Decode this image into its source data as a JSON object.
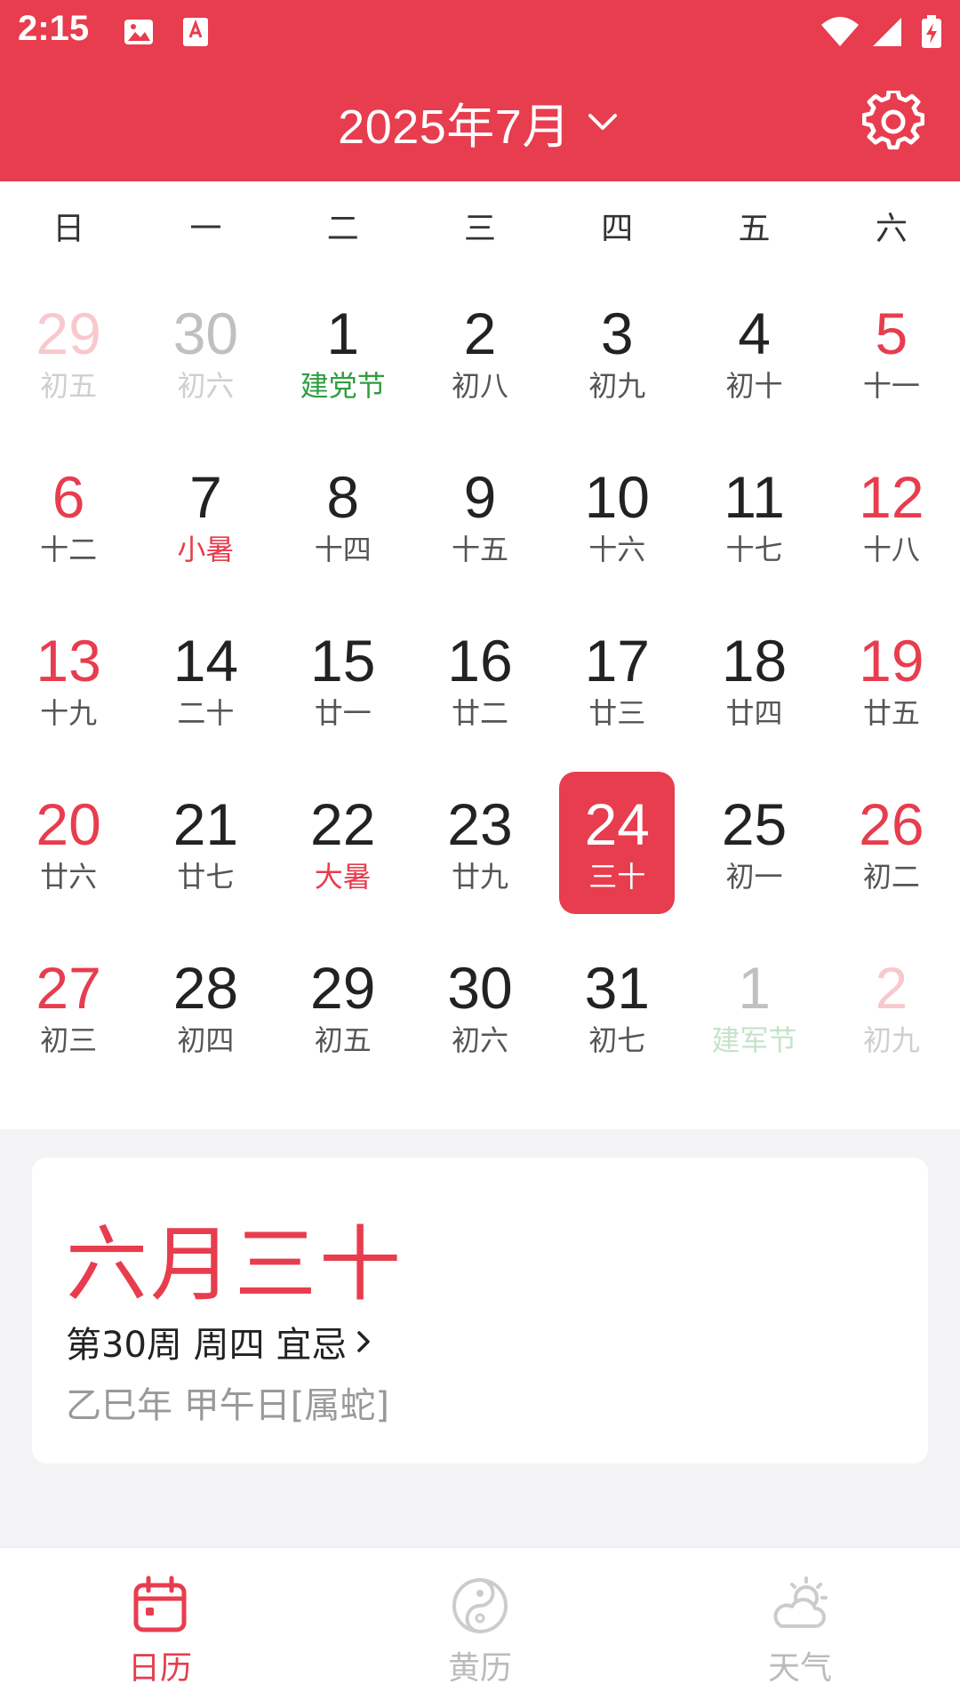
{
  "status": {
    "time": "2:15"
  },
  "header": {
    "title": "2025年7月"
  },
  "weekdays": [
    "日",
    "一",
    "二",
    "三",
    "四",
    "五",
    "六"
  ],
  "days": [
    {
      "num": "29",
      "lunar": "初五",
      "weekend": true,
      "faded": true
    },
    {
      "num": "30",
      "lunar": "初六",
      "faded": true
    },
    {
      "num": "1",
      "lunar": "建党节",
      "lunar_color": "green"
    },
    {
      "num": "2",
      "lunar": "初八"
    },
    {
      "num": "3",
      "lunar": "初九"
    },
    {
      "num": "4",
      "lunar": "初十"
    },
    {
      "num": "5",
      "lunar": "十一",
      "weekend": true
    },
    {
      "num": "6",
      "lunar": "十二",
      "weekend": true
    },
    {
      "num": "7",
      "lunar": "小暑",
      "lunar_color": "red"
    },
    {
      "num": "8",
      "lunar": "十四"
    },
    {
      "num": "9",
      "lunar": "十五"
    },
    {
      "num": "10",
      "lunar": "十六"
    },
    {
      "num": "11",
      "lunar": "十七"
    },
    {
      "num": "12",
      "lunar": "十八",
      "weekend": true
    },
    {
      "num": "13",
      "lunar": "十九",
      "weekend": true
    },
    {
      "num": "14",
      "lunar": "二十"
    },
    {
      "num": "15",
      "lunar": "廿一"
    },
    {
      "num": "16",
      "lunar": "廿二"
    },
    {
      "num": "17",
      "lunar": "廿三"
    },
    {
      "num": "18",
      "lunar": "廿四"
    },
    {
      "num": "19",
      "lunar": "廿五",
      "weekend": true
    },
    {
      "num": "20",
      "lunar": "廿六",
      "weekend": true
    },
    {
      "num": "21",
      "lunar": "廿七"
    },
    {
      "num": "22",
      "lunar": "大暑",
      "lunar_color": "red"
    },
    {
      "num": "23",
      "lunar": "廿九"
    },
    {
      "num": "24",
      "lunar": "三十",
      "selected": true
    },
    {
      "num": "25",
      "lunar": "初一"
    },
    {
      "num": "26",
      "lunar": "初二",
      "weekend": true
    },
    {
      "num": "27",
      "lunar": "初三",
      "weekend": true
    },
    {
      "num": "28",
      "lunar": "初四"
    },
    {
      "num": "29",
      "lunar": "初五"
    },
    {
      "num": "30",
      "lunar": "初六"
    },
    {
      "num": "31",
      "lunar": "初七"
    },
    {
      "num": "1",
      "lunar": "建军节",
      "lunar_color": "green",
      "faded": true
    },
    {
      "num": "2",
      "lunar": "初九",
      "weekend": true,
      "faded": true
    }
  ],
  "detail": {
    "lunar_date": "六月三十",
    "line1": "第30周 周四 宜忌",
    "line2": "乙巳年 甲午日[属蛇]"
  },
  "nav": [
    {
      "label": "日历",
      "icon": "calendar-icon",
      "active": true
    },
    {
      "label": "黄历",
      "icon": "yin-yang-icon"
    },
    {
      "label": "天气",
      "icon": "weather-icon"
    }
  ],
  "colors": {
    "accent": "#e73d4e",
    "green": "#2f9e40"
  }
}
